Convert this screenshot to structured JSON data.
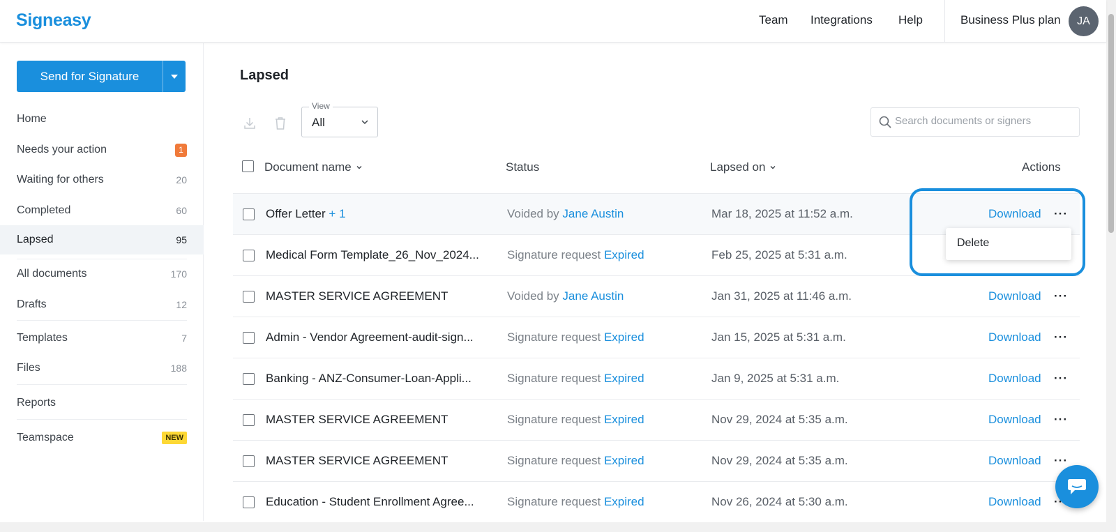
{
  "header": {
    "logo": "Signeasy",
    "nav": [
      "Team",
      "Integrations",
      "Help"
    ],
    "plan": "Business Plus plan",
    "avatar_initials": "JA"
  },
  "sidebar": {
    "send_button": "Send for Signature",
    "items": [
      {
        "label": "Home",
        "count": ""
      },
      {
        "label": "Needs your action",
        "count": "1"
      },
      {
        "label": "Waiting for others",
        "count": "20"
      },
      {
        "label": "Completed",
        "count": "60"
      },
      {
        "label": "Lapsed",
        "count": "95"
      },
      {
        "label": "All documents",
        "count": "170"
      },
      {
        "label": "Drafts",
        "count": "12"
      },
      {
        "label": "Templates",
        "count": "7"
      },
      {
        "label": "Files",
        "count": "188"
      },
      {
        "label": "Reports",
        "count": ""
      },
      {
        "label": "Teamspace",
        "count": "NEW"
      }
    ]
  },
  "main": {
    "title": "Lapsed",
    "view_legend": "View",
    "view_value": "All",
    "search_placeholder": "Search documents or signers",
    "columns": {
      "name": "Document name",
      "status": "Status",
      "date": "Lapsed on",
      "actions": "Actions"
    },
    "rows": [
      {
        "name": "Offer Letter",
        "extra": "+ 1",
        "status_prefix": "Voided by",
        "status_value": "Jane Austin",
        "date": "Mar 18, 2025 at 11:52 a.m.",
        "action": "Download"
      },
      {
        "name": "Medical Form Template_26_Nov_2024...",
        "extra": "",
        "status_prefix": "Signature request",
        "status_value": "Expired",
        "date": "Feb 25, 2025 at 5:31 a.m.",
        "action": ""
      },
      {
        "name": "MASTER SERVICE AGREEMENT",
        "extra": "",
        "status_prefix": "Voided by",
        "status_value": "Jane Austin",
        "date": "Jan 31, 2025 at 11:46 a.m.",
        "action": "Download"
      },
      {
        "name": "Admin - Vendor Agreement-audit-sign...",
        "extra": "",
        "status_prefix": "Signature request",
        "status_value": "Expired",
        "date": "Jan 15, 2025 at 5:31 a.m.",
        "action": "Download"
      },
      {
        "name": "Banking - ANZ-Consumer-Loan-Appli...",
        "extra": "",
        "status_prefix": "Signature request",
        "status_value": "Expired",
        "date": "Jan 9, 2025 at 5:31 a.m.",
        "action": "Download"
      },
      {
        "name": "MASTER SERVICE AGREEMENT",
        "extra": "",
        "status_prefix": "Signature request",
        "status_value": "Expired",
        "date": "Nov 29, 2024 at 5:35 a.m.",
        "action": "Download"
      },
      {
        "name": "MASTER SERVICE AGREEMENT",
        "extra": "",
        "status_prefix": "Signature request",
        "status_value": "Expired",
        "date": "Nov 29, 2024 at 5:35 a.m.",
        "action": "Download"
      },
      {
        "name": "Education - Student Enrollment Agree...",
        "extra": "",
        "status_prefix": "Signature request",
        "status_value": "Expired",
        "date": "Nov 26, 2024 at 5:30 a.m.",
        "action": "Download"
      }
    ],
    "dropdown_item": "Delete",
    "dots": "···"
  },
  "colors": {
    "accent": "#1a8fdd",
    "badge": "#f07a3a",
    "new_badge": "#fdd835"
  }
}
